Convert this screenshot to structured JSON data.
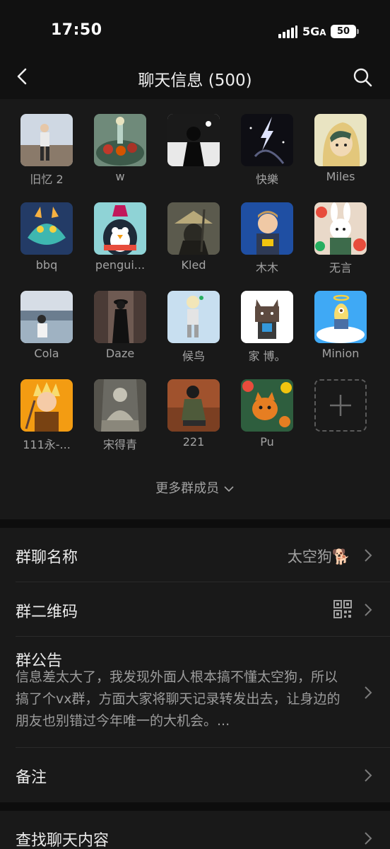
{
  "status_bar": {
    "time": "17:50",
    "network": "5G",
    "network_suffix": "A",
    "battery": "50"
  },
  "nav": {
    "title": "聊天信息 (500)",
    "back_icon": "chevron-left-icon",
    "search_icon": "search-icon"
  },
  "members": [
    {
      "name": "旧忆 2"
    },
    {
      "name": "w"
    },
    {
      "name": ""
    },
    {
      "name": "快樂"
    },
    {
      "name": "Miles"
    },
    {
      "name": "bbq"
    },
    {
      "name": "pengui..."
    },
    {
      "name": "Kled"
    },
    {
      "name": "木木"
    },
    {
      "name": "无言"
    },
    {
      "name": "Cola"
    },
    {
      "name": "Daze"
    },
    {
      "name": "候鸟"
    },
    {
      "name": "家 博。"
    },
    {
      "name": "Minion"
    },
    {
      "name": "111永-..."
    },
    {
      "name": "宋得青"
    },
    {
      "name": "221"
    },
    {
      "name": "Pu"
    }
  ],
  "more_members_label": "更多群成员",
  "settings": {
    "group_name_label": "群聊名称",
    "group_name_value": "太空狗🐕",
    "qr_label": "群二维码",
    "announcement_label": "群公告",
    "announcement_text": "信息差太大了，我发现外面人根本搞不懂太空狗，所以搞了个vx群，方面大家将聊天记录转发出去，让身边的朋友也别错过今年唯一的大机会。...",
    "remark_label": "备注",
    "search_history_label": "查找聊天内容"
  },
  "colors": {
    "background": "#111111",
    "panel": "#191919",
    "text_primary": "#eaeaea",
    "text_secondary": "#a3a3a3"
  }
}
